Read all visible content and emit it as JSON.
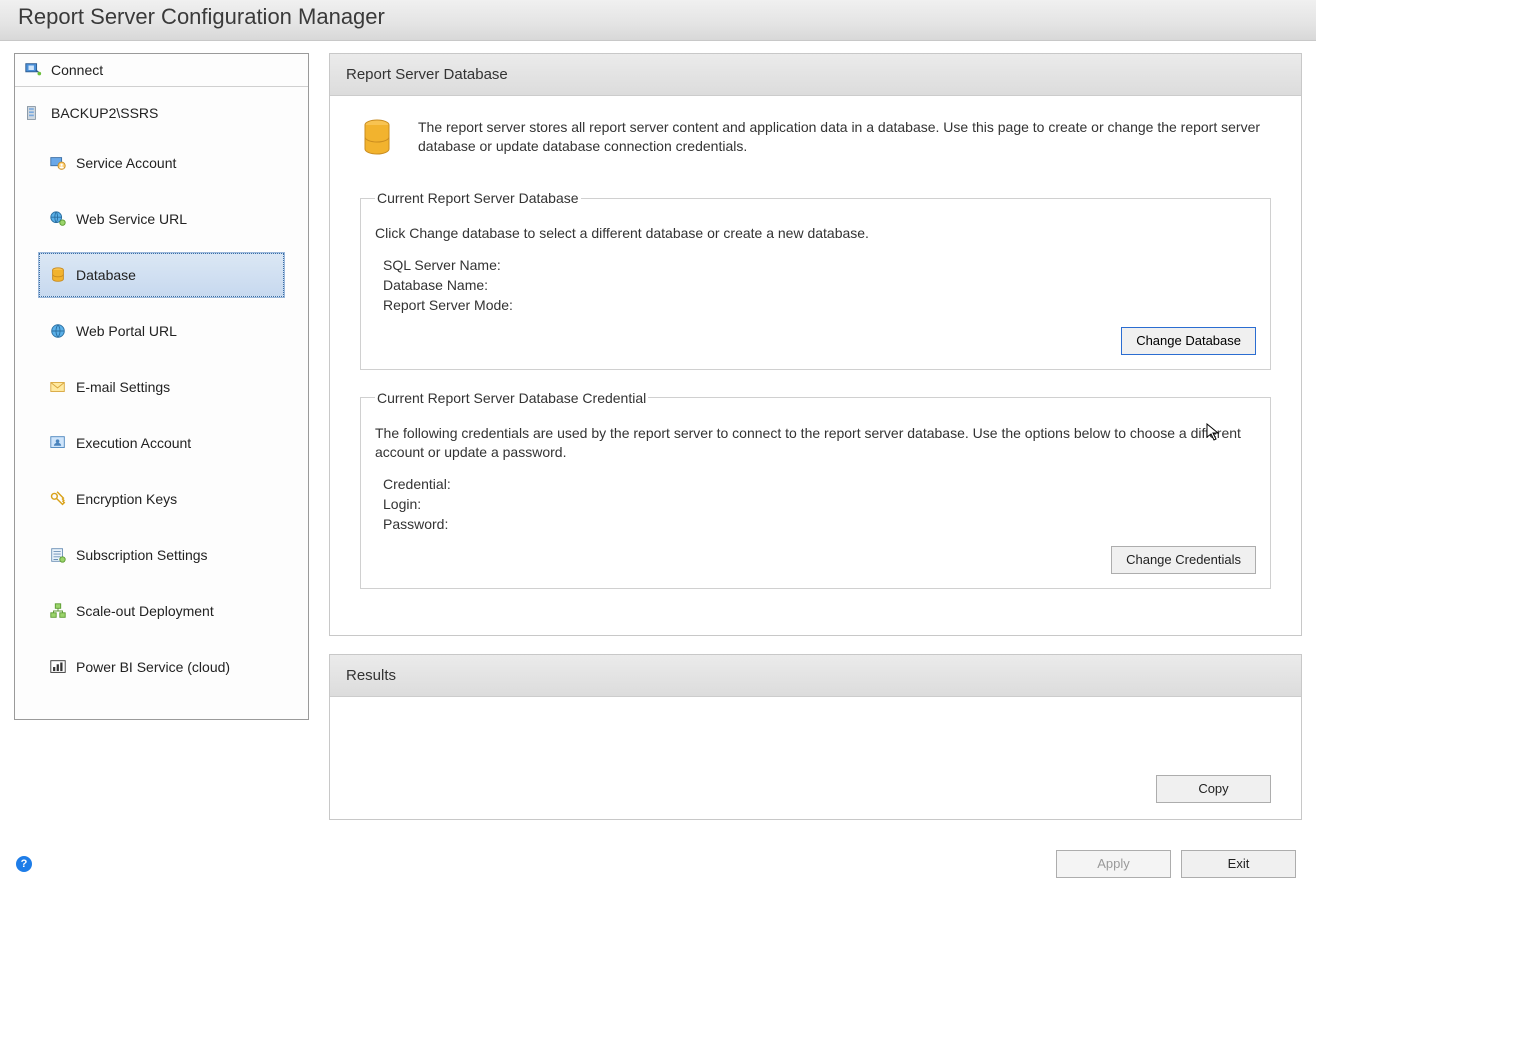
{
  "header": {
    "title": "Report Server Configuration Manager"
  },
  "sidebar": {
    "connect_label": "Connect",
    "server_instance": "BACKUP2\\SSRS",
    "items": [
      {
        "label": "Service Account"
      },
      {
        "label": "Web Service URL"
      },
      {
        "label": "Database"
      },
      {
        "label": "Web Portal URL"
      },
      {
        "label": "E-mail Settings"
      },
      {
        "label": "Execution Account"
      },
      {
        "label": "Encryption Keys"
      },
      {
        "label": "Subscription Settings"
      },
      {
        "label": "Scale-out Deployment"
      },
      {
        "label": "Power BI Service (cloud)"
      }
    ]
  },
  "main": {
    "panel_title": "Report Server Database",
    "intro": "The report server stores all report server content and application data in a database. Use this page to create or change the report server database or update database connection credentials.",
    "db_group": {
      "legend": "Current Report Server Database",
      "text": "Click Change database to select a different database or create a new database.",
      "sql_server_label": "SQL Server Name:",
      "db_name_label": "Database Name:",
      "mode_label": "Report Server Mode:",
      "change_btn": "Change Database"
    },
    "cred_group": {
      "legend": "Current Report Server Database Credential",
      "text": "The following credentials are used by the report server to connect to the report server database.  Use the options below to choose a different account or update a password.",
      "cred_label": "Credential:",
      "login_label": "Login:",
      "pwd_label": "Password:",
      "change_btn": "Change Credentials"
    },
    "results": {
      "title": "Results",
      "copy_btn": "Copy"
    }
  },
  "footer": {
    "apply": "Apply",
    "exit": "Exit"
  }
}
